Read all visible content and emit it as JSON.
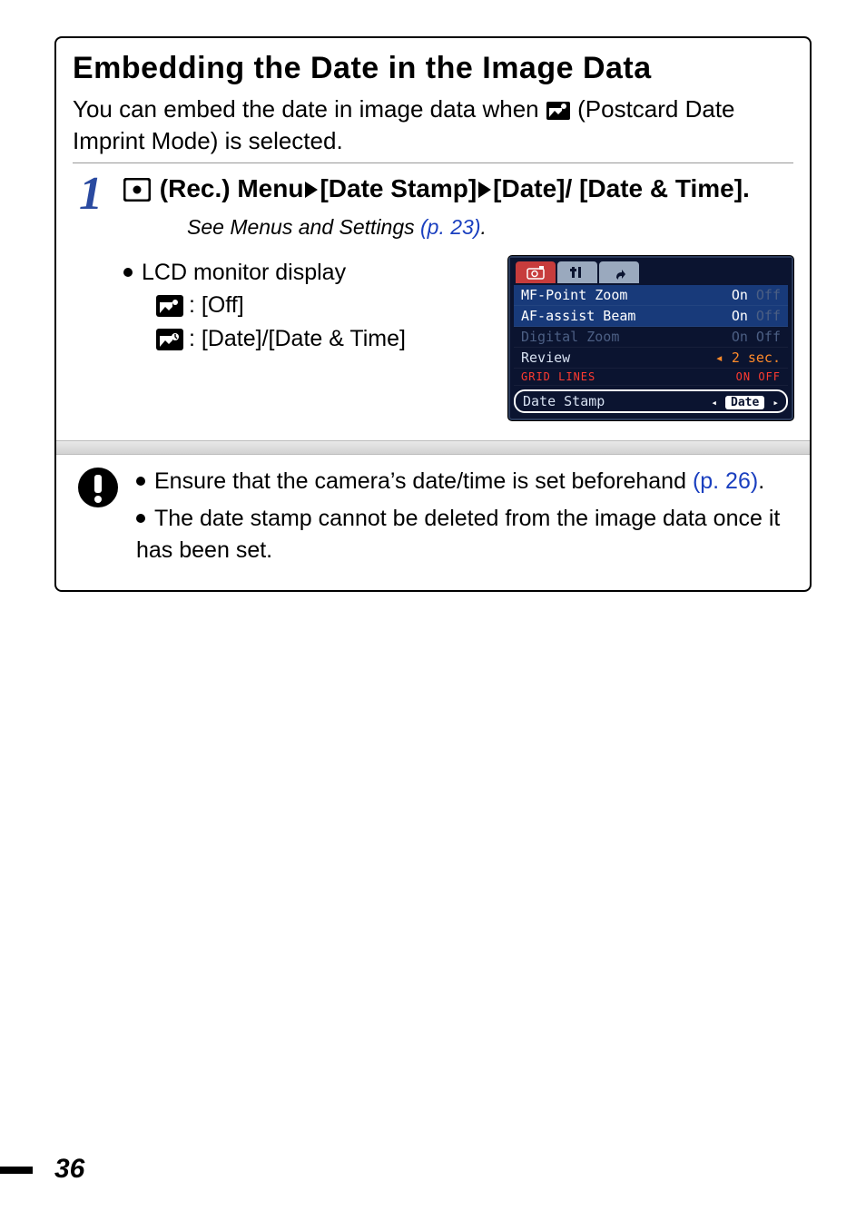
{
  "title": "Embedding the Date in the Image Data",
  "intro_pre": "You can embed the date in image data when ",
  "intro_post": " (Postcard Date Imprint Mode) is selected.",
  "step": {
    "number": "1",
    "menu_label": " (Rec.) Menu",
    "date_stamp": "[Date Stamp]",
    "date": "[Date]",
    "date_time_suffix": "/ [Date & Time].",
    "see_pre": "See Menus and Settings ",
    "see_link": "(p. 23)",
    "see_post": ".",
    "lcd_label": "LCD monitor display",
    "off_value": ": [Off]",
    "date_value": ": [Date]/[Date & Time]"
  },
  "lcd": {
    "items": [
      {
        "label": "MF-Point Zoom",
        "on": "On",
        "off": "Off"
      },
      {
        "label": "AF-assist Beam",
        "on": "On",
        "off": "Off"
      },
      {
        "label": "Digital Zoom",
        "on": "On",
        "off": "Off"
      },
      {
        "label": "Review",
        "val": "2 sec.",
        "arrow": true
      },
      {
        "label": "Grid Lines",
        "on": "On",
        "off": "Off"
      }
    ],
    "stamp_label": "Date Stamp",
    "stamp_value": "Date"
  },
  "notes": {
    "n1_pre": "Ensure that the camera’s date/time is set beforehand ",
    "n1_link": "(p. 26)",
    "n1_post": ".",
    "n2": "The date stamp cannot be deleted from the image data once it has been set."
  },
  "page_number": "36"
}
